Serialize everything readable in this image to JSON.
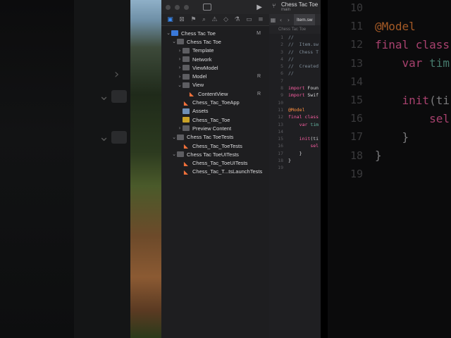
{
  "window": {
    "project_title": "Chess Tac Toe",
    "branch": "main"
  },
  "navigator": {
    "tabs": [
      "folder-icon",
      "x-square-icon",
      "bookmark-icon",
      "search-icon",
      "warning-icon",
      "diamond-icon",
      "spray-icon",
      "speech-icon",
      "list-icon"
    ],
    "tree": [
      {
        "depth": 0,
        "chevron": "open",
        "icon": "project",
        "label": "Chess Tac Toe",
        "badge": "M"
      },
      {
        "depth": 1,
        "chevron": "open",
        "icon": "folder",
        "label": "Chess Tac Toe",
        "badge": ""
      },
      {
        "depth": 2,
        "chevron": "closed",
        "icon": "folder",
        "label": "Template",
        "badge": ""
      },
      {
        "depth": 2,
        "chevron": "closed",
        "icon": "folder",
        "label": "Network",
        "badge": ""
      },
      {
        "depth": 2,
        "chevron": "closed",
        "icon": "folder",
        "label": "ViewModel",
        "badge": ""
      },
      {
        "depth": 2,
        "chevron": "closed",
        "icon": "folder",
        "label": "Model",
        "badge": "R"
      },
      {
        "depth": 2,
        "chevron": "open",
        "icon": "folder",
        "label": "View",
        "badge": ""
      },
      {
        "depth": 3,
        "chevron": "",
        "icon": "swift",
        "label": "ContentView",
        "badge": "R"
      },
      {
        "depth": 2,
        "chevron": "",
        "icon": "swift",
        "label": "Chess_Tac_ToeApp",
        "badge": ""
      },
      {
        "depth": 2,
        "chevron": "",
        "icon": "assets",
        "label": "Assets",
        "badge": ""
      },
      {
        "depth": 2,
        "chevron": "",
        "icon": "entitlements",
        "label": "Chess_Tac_Toe",
        "badge": ""
      },
      {
        "depth": 2,
        "chevron": "closed",
        "icon": "folder",
        "label": "Preview Content",
        "badge": ""
      },
      {
        "depth": 1,
        "chevron": "open",
        "icon": "folder",
        "label": "Chess Tac ToeTests",
        "badge": ""
      },
      {
        "depth": 2,
        "chevron": "",
        "icon": "swift",
        "label": "Chess_Tac_ToeTests",
        "badge": ""
      },
      {
        "depth": 1,
        "chevron": "open",
        "icon": "folder",
        "label": "Chess Tac ToeUITests",
        "badge": ""
      },
      {
        "depth": 2,
        "chevron": "",
        "icon": "swift",
        "label": "Chess_Tac_ToeUITests",
        "badge": ""
      },
      {
        "depth": 2,
        "chevron": "",
        "icon": "swift",
        "label": "Chess_Tac_T...tsLaunchTests",
        "badge": ""
      }
    ]
  },
  "editor": {
    "tab_label": "Item.sw",
    "jump_bar": "Chess Tac Toe",
    "lines": [
      {
        "n": "1",
        "tokens": [
          {
            "t": "//",
            "c": "comment"
          }
        ]
      },
      {
        "n": "2",
        "tokens": [
          {
            "t": "//  Item.sw",
            "c": "comment"
          }
        ]
      },
      {
        "n": "3",
        "tokens": [
          {
            "t": "//  Chess T",
            "c": "comment"
          }
        ]
      },
      {
        "n": "4",
        "tokens": [
          {
            "t": "//",
            "c": "comment"
          }
        ]
      },
      {
        "n": "5",
        "tokens": [
          {
            "t": "//  Created",
            "c": "comment"
          }
        ]
      },
      {
        "n": "6",
        "tokens": [
          {
            "t": "//",
            "c": "comment"
          }
        ]
      },
      {
        "n": "7",
        "tokens": []
      },
      {
        "n": "8",
        "tokens": [
          {
            "t": "import ",
            "c": "kw"
          },
          {
            "t": "Foun",
            "c": "plain"
          }
        ]
      },
      {
        "n": "9",
        "tokens": [
          {
            "t": "import ",
            "c": "kw"
          },
          {
            "t": "Swif",
            "c": "plain"
          }
        ]
      },
      {
        "n": "10",
        "tokens": []
      },
      {
        "n": "11",
        "tokens": [
          {
            "t": "@Model",
            "c": "attr"
          }
        ]
      },
      {
        "n": "12",
        "tokens": [
          {
            "t": "final class",
            "c": "kw"
          }
        ]
      },
      {
        "n": "13",
        "tokens": [
          {
            "t": "    ",
            "c": "plain"
          },
          {
            "t": "var ",
            "c": "kw"
          },
          {
            "t": "tim",
            "c": "ident"
          }
        ]
      },
      {
        "n": "14",
        "tokens": []
      },
      {
        "n": "15",
        "tokens": [
          {
            "t": "    ",
            "c": "plain"
          },
          {
            "t": "init",
            "c": "kw"
          },
          {
            "t": "(ti",
            "c": "plain"
          }
        ]
      },
      {
        "n": "16",
        "tokens": [
          {
            "t": "        ",
            "c": "plain"
          },
          {
            "t": "sel",
            "c": "kw"
          }
        ]
      },
      {
        "n": "17",
        "tokens": [
          {
            "t": "    }",
            "c": "plain"
          }
        ]
      },
      {
        "n": "18",
        "tokens": [
          {
            "t": "}",
            "c": "plain"
          }
        ]
      },
      {
        "n": "19",
        "tokens": []
      }
    ]
  },
  "zoomed_code": {
    "lines": [
      {
        "n": "10",
        "tokens": []
      },
      {
        "n": "11",
        "tokens": [
          {
            "t": "@Model",
            "c": "attr"
          }
        ]
      },
      {
        "n": "12",
        "tokens": [
          {
            "t": "final class",
            "c": "kw"
          }
        ]
      },
      {
        "n": "13",
        "tokens": [
          {
            "t": "    ",
            "c": "plain"
          },
          {
            "t": "var ",
            "c": "kw"
          },
          {
            "t": "tim",
            "c": "ident"
          }
        ]
      },
      {
        "n": "14",
        "tokens": []
      },
      {
        "n": "15",
        "tokens": [
          {
            "t": "    ",
            "c": "plain"
          },
          {
            "t": "init",
            "c": "kw"
          },
          {
            "t": "(ti",
            "c": "plain"
          }
        ]
      },
      {
        "n": "16",
        "tokens": [
          {
            "t": "        ",
            "c": "plain"
          },
          {
            "t": "sel",
            "c": "kw"
          }
        ]
      },
      {
        "n": "17",
        "tokens": [
          {
            "t": "    }",
            "c": "plain"
          }
        ]
      },
      {
        "n": "18",
        "tokens": [
          {
            "t": "}",
            "c": "plain"
          }
        ]
      },
      {
        "n": "19",
        "tokens": []
      }
    ]
  }
}
